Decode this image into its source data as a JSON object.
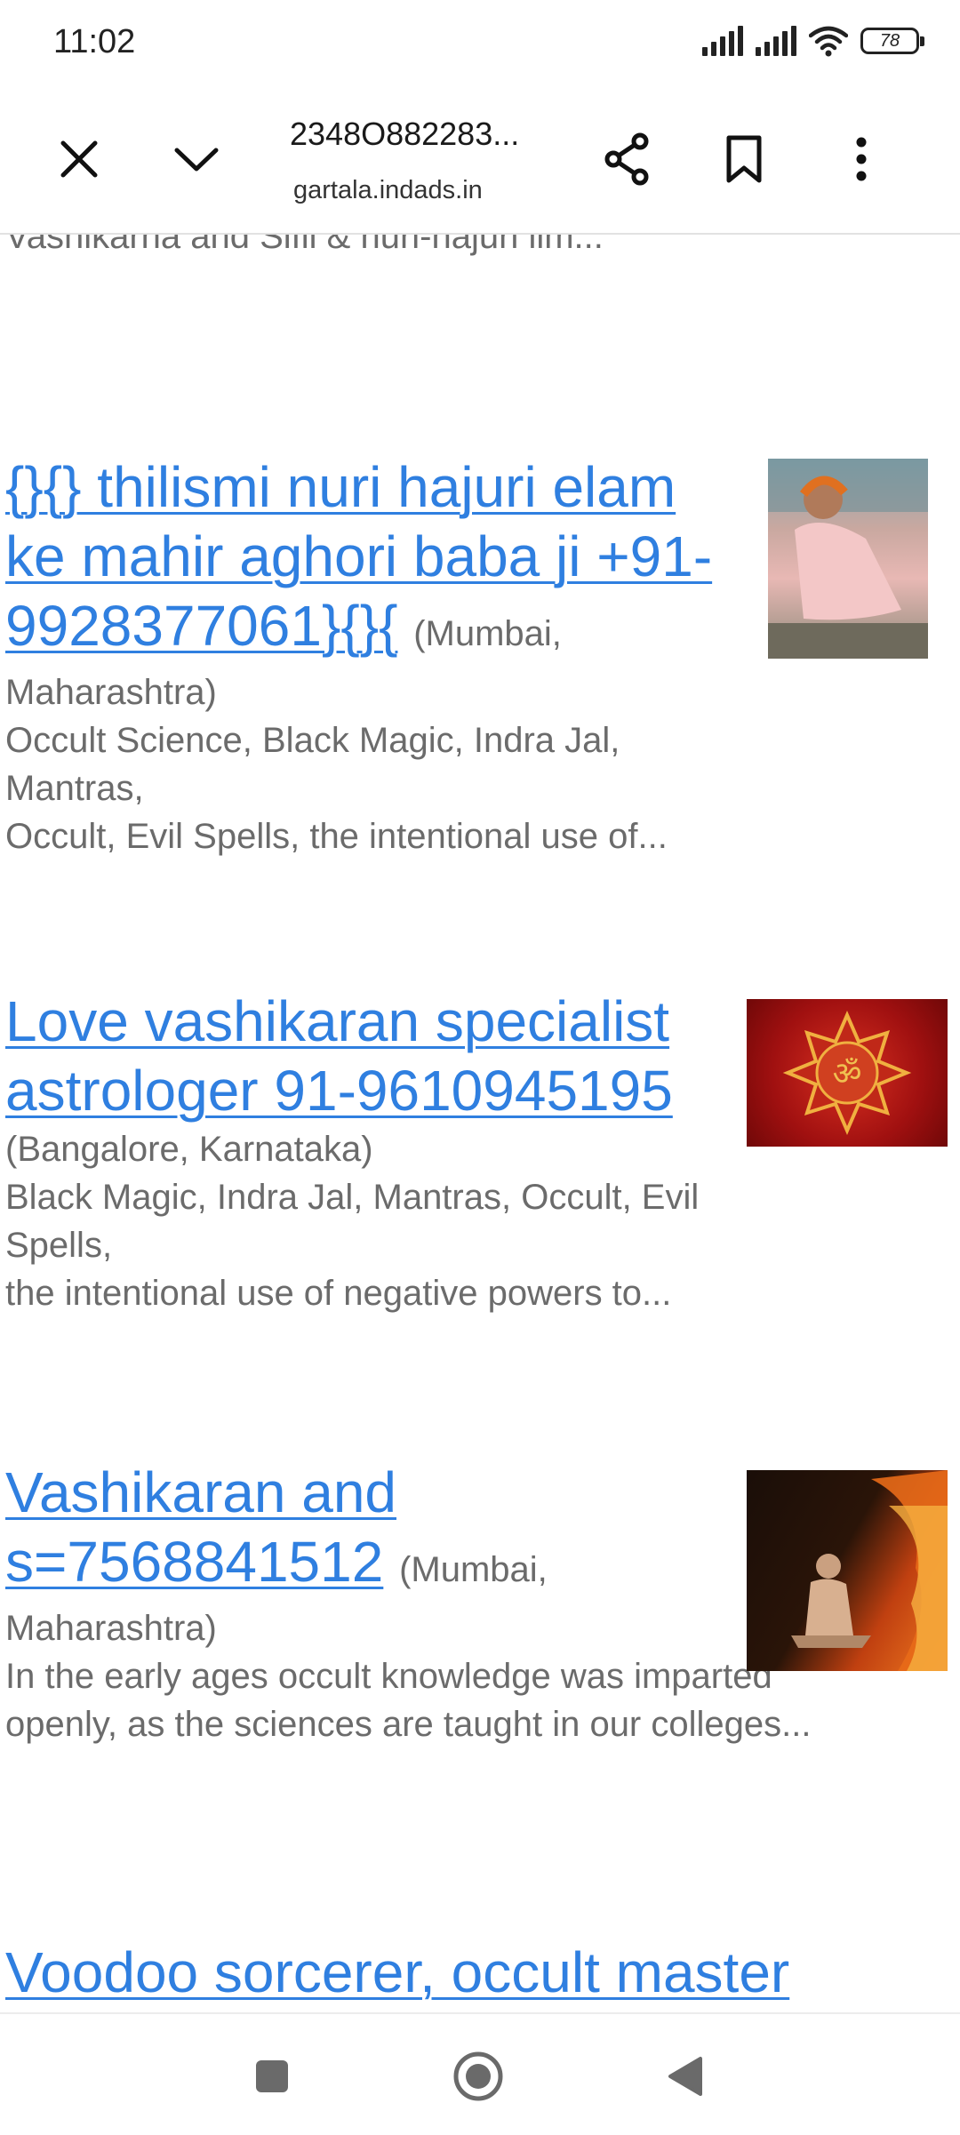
{
  "status_bar": {
    "time": "11:02",
    "battery_level": "78",
    "icons": [
      "signal-icon",
      "signal-icon",
      "wifi-icon",
      "battery-icon"
    ]
  },
  "toolbar": {
    "page_title": "2348O882283...",
    "url": "gartala.indads.in",
    "icons": [
      "close-icon",
      "chevron-down-icon",
      "share-icon",
      "bookmark-icon",
      "more-vert-icon"
    ]
  },
  "content": {
    "partial_snippet": "Vashikarna and Sifli & nuri-hajuri ilm...",
    "listings": [
      {
        "title": "{}{} thilismi nuri hajuri elam ke mahir aghori baba ji +91-9928377061}{}{",
        "title_lines": [
          "{}{} thilismi nuri hajuri elam",
          "ke mahir aghori baba ji +91-",
          "9928377061}{}{"
        ],
        "location": "(Mumbai, Maharashtra)",
        "location_lines": [
          "(Mumbai,",
          "Maharashtra)"
        ],
        "description": "Occult Science, Black Magic, Indra Jal, Mantras, Occult, Evil Spells, the intentional use of...",
        "description_lines": [
          "Occult Science, Black Magic, Indra Jal, Mantras,",
          "Occult, Evil Spells, the intentional use of..."
        ]
      },
      {
        "title": "Love vashikaran specialist astrologer 91-9610945195",
        "title_lines": [
          "Love vashikaran specialist",
          "astrologer 91-9610945195"
        ],
        "location": "(Bangalore, Karnataka)",
        "description": "Black Magic, Indra Jal, Mantras, Occult, Evil Spells, the intentional use of negative powers to...",
        "description_lines": [
          "Black Magic, Indra Jal, Mantras, Occult, Evil Spells,",
          "the intentional use of negative powers to..."
        ]
      },
      {
        "title": "Vashikaran and s=7568841512",
        "title_lines": [
          "Vashikaran and",
          "s=7568841512"
        ],
        "location": "(Mumbai, Maharashtra)",
        "location_lines": [
          "(Mumbai,",
          "Maharashtra)"
        ],
        "description": "In the early ages occult knowledge was imparted openly, as the sciences are taught in our colleges...",
        "description_lines": [
          "In the early ages occult knowledge was imparted",
          "openly, as the sciences are taught in our colleges..."
        ]
      },
      {
        "title": "Voodoo sorcerer, occult master"
      }
    ]
  },
  "nav_bar": {
    "icons": [
      "recents-square-icon",
      "home-circle-icon",
      "back-triangle-icon"
    ]
  },
  "colors": {
    "link": "#2f7fe0",
    "text_muted": "#6b6b6b",
    "ink": "#1a1a1a"
  }
}
